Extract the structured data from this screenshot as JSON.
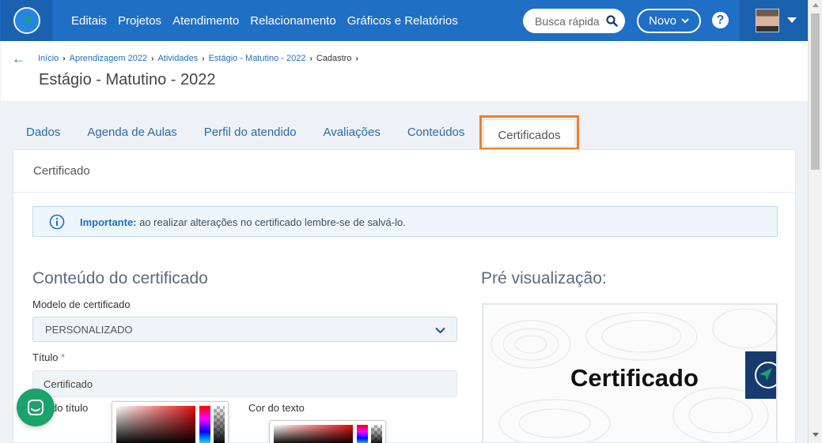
{
  "nav": {
    "items": [
      "Editais",
      "Projetos",
      "Atendimento",
      "Relacionamento",
      "Gráficos e Relatórios"
    ],
    "search_placeholder": "Busca rápida",
    "new_button": "Novo",
    "help": "?"
  },
  "breadcrumb": {
    "items": [
      "Início",
      "Aprendizagem 2022",
      "Atividades",
      "Estágio - Matutino - 2022"
    ],
    "current": "Cadastro"
  },
  "page_title": "Estágio - Matutino - 2022",
  "tabs": [
    "Dados",
    "Agenda de Aulas",
    "Perfil do atendido",
    "Avaliações",
    "Conteúdos",
    "Certificados"
  ],
  "card": {
    "title": "Certificado",
    "alert_bold": "Importante:",
    "alert_text": " ao realizar alterações no certificado lembre-se de salvá-lo.",
    "content_title": "Conteúdo do certificado",
    "model_label": "Modelo de certificado",
    "model_value": "PERSONALIZADO",
    "title_label": "Título",
    "title_required": "*",
    "title_value": "Certificado",
    "title_color_label": "do título",
    "text_color_label": "Cor do texto",
    "preview_title": "Pré visualização:",
    "preview_cert_text": "Certificado"
  },
  "colors": {
    "nav_bg": "#1f6fc4",
    "active_tab_highlight": "#f07f2a",
    "chat_button": "#1aa36b"
  }
}
